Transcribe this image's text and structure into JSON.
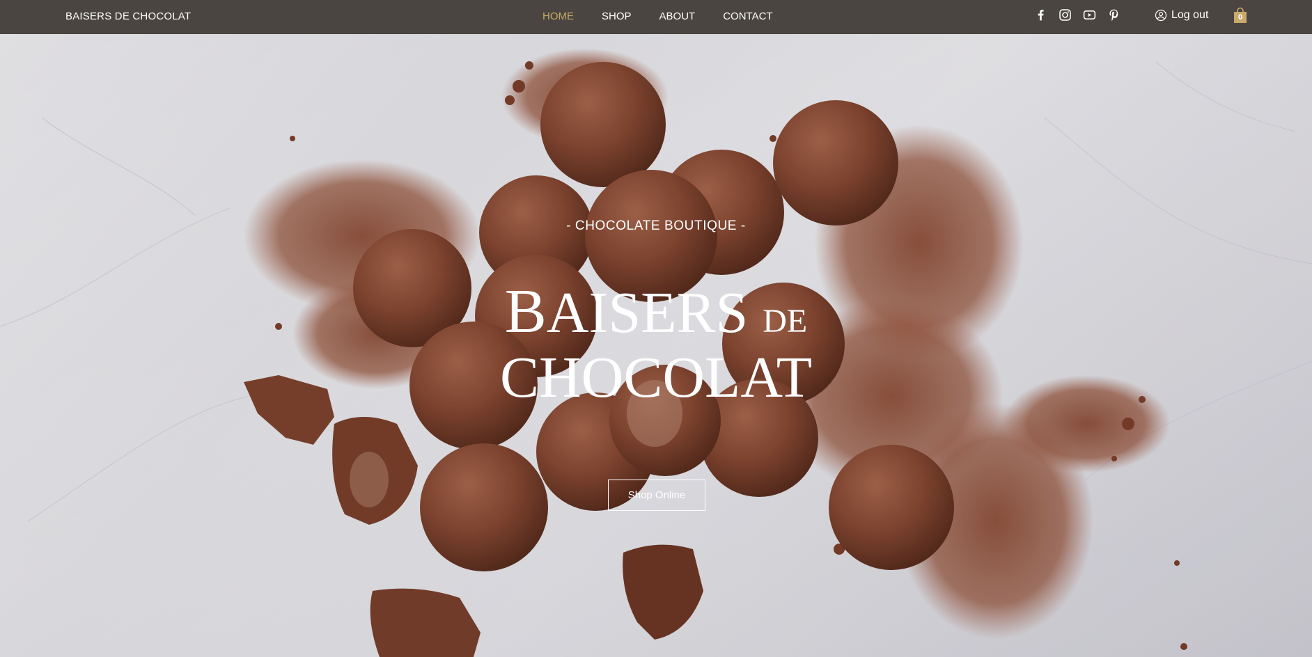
{
  "brand": "BAISERS DE CHOCOLAT",
  "nav": {
    "home": "HOME",
    "shop": "SHOP",
    "about": "ABOUT",
    "contact": "CONTACT",
    "active": "HOME"
  },
  "social": [
    "facebook-icon",
    "instagram-icon",
    "youtube-icon",
    "pinterest-icon"
  ],
  "account": {
    "login_label": "Log out"
  },
  "cart": {
    "count": "0"
  },
  "hero": {
    "subtitle": "- CHOCOLATE BOUTIQUE -",
    "title_word1_initial": "B",
    "title_word1_rest": "AISERS",
    "title_small": "DE",
    "title_line2": "CHOCOLAT",
    "cta_label": "Shop Online"
  },
  "colors": {
    "header_bg": "#4a4540",
    "accent": "#c9a96c",
    "text": "#ffffff",
    "chocolate": "#8a4c36"
  }
}
